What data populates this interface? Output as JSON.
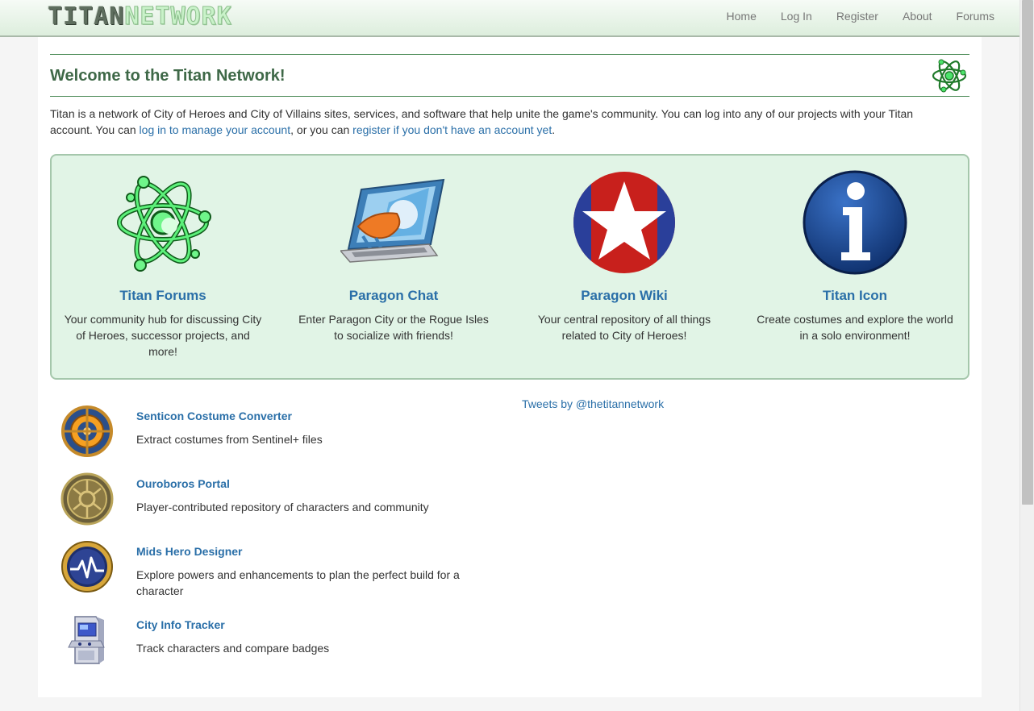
{
  "brand": {
    "part1": "TITAN",
    "part2": "NETWORK"
  },
  "nav": [
    "Home",
    "Log In",
    "Register",
    "About",
    "Forums"
  ],
  "page": {
    "title": "Welcome to the Titan Network!",
    "intro_prefix": "Titan is a network of City of Heroes and City of Villains sites, services, and software that help unite the game's community. You can log into any of our projects with your Titan account. You can ",
    "intro_link1": "log in to manage your account",
    "intro_mid": ", or you can ",
    "intro_link2": "register if you don't have an account yet",
    "intro_suffix": "."
  },
  "features": [
    {
      "icon": "atom-icon",
      "title": "Titan Forums",
      "desc": "Your community hub for discussing City of Heroes, successor projects, and more!"
    },
    {
      "icon": "laptop-icon",
      "title": "Paragon Chat",
      "desc": "Enter Paragon City or the Rogue Isles to socialize with friends!"
    },
    {
      "icon": "star-icon",
      "title": "Paragon Wiki",
      "desc": "Your central repository of all things related to City of Heroes!"
    },
    {
      "icon": "info-icon",
      "title": "Titan Icon",
      "desc": "Create costumes and explore the world in a solo environment!"
    }
  ],
  "tools": [
    {
      "icon": "crosshair-icon",
      "title": "Senticon Costume Converter",
      "desc": "Extract costumes from Sentinel+ files"
    },
    {
      "icon": "portal-icon",
      "title": "Ouroboros Portal",
      "desc": "Player-contributed repository of characters and community"
    },
    {
      "icon": "pulse-icon",
      "title": "Mids Hero Designer",
      "desc": "Explore powers and enhancements to plan the perfect build for a character"
    },
    {
      "icon": "arcade-icon",
      "title": "City Info Tracker",
      "desc": "Track characters and compare badges"
    }
  ],
  "tweets_link": "Tweets by @thetitannetwork",
  "colors": {
    "link": "#2a6fa8",
    "title_green": "#3e6847",
    "panel_bg": "#e1f4e6"
  }
}
